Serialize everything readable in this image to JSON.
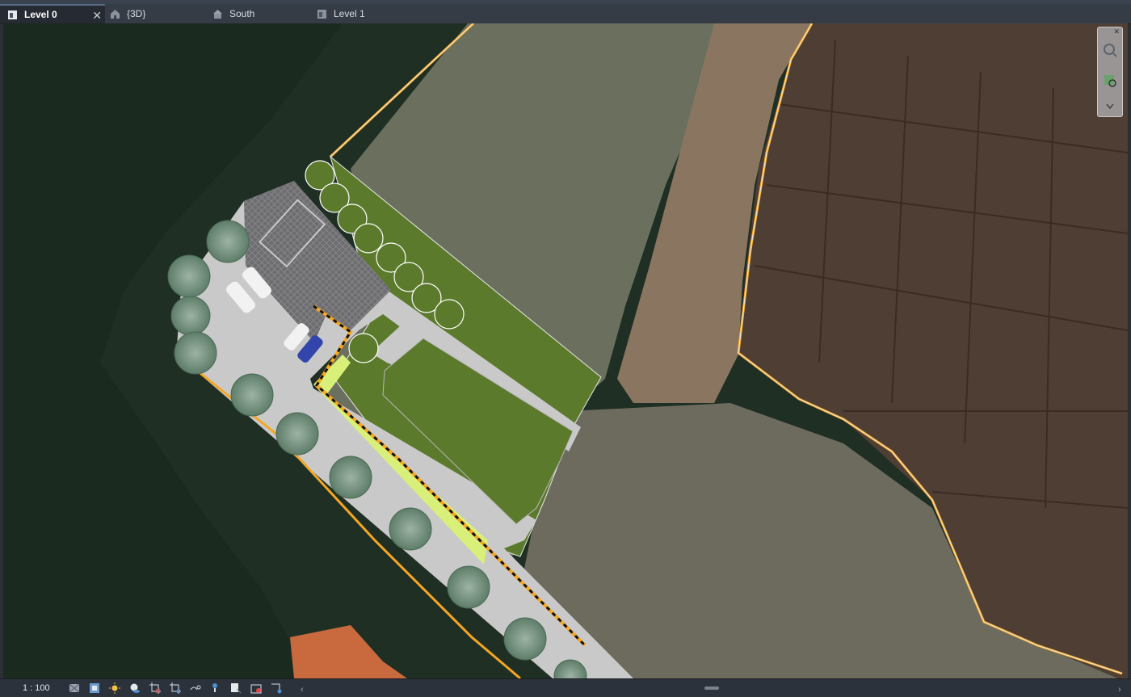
{
  "tabs": [
    {
      "label": "Level 0",
      "icon": "floor-plan-icon",
      "active": true
    },
    {
      "label": "{3D}",
      "icon": "house-3d-icon",
      "active": false
    },
    {
      "label": "South",
      "icon": "elevation-icon",
      "active": false
    },
    {
      "label": "Level 1",
      "icon": "floor-plan-icon",
      "active": false
    }
  ],
  "close_glyph": "✕",
  "viewport": {
    "description_icon": "site-plan-view"
  },
  "navbar": {
    "close_glyph": "✕",
    "icons": [
      "orbit-icon",
      "zoom-region-icon",
      "chevron-down-icon"
    ]
  },
  "status": {
    "scale": "1 : 100",
    "icons": [
      "detail-level-icon",
      "visual-style-icon",
      "sun-path-icon",
      "shadows-icon",
      "crop-view-icon",
      "show-crop-region-icon",
      "temporary-hide-icon",
      "reveal-hidden-icon",
      "worksharing-icon",
      "analytical-model-icon",
      "highlight-boundaries-icon"
    ],
    "scroll_left": "‹",
    "scroll_right": "›"
  },
  "colors": {
    "accent_tab": "#262b33",
    "boundary": "#f5a623",
    "lawn": "#5c7a2c",
    "paving": "#c9c9c9"
  }
}
